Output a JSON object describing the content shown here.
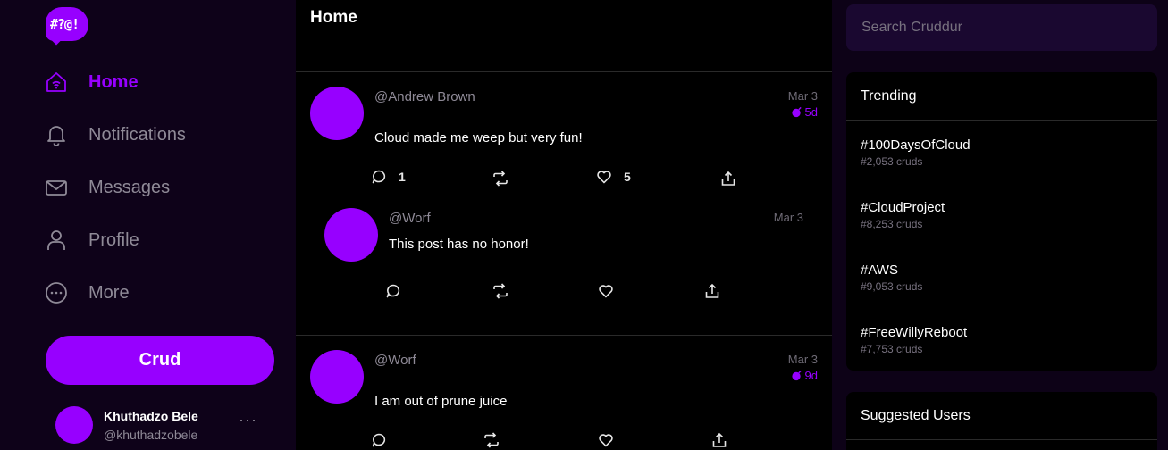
{
  "logo": {
    "text": "#?@!"
  },
  "nav": {
    "home": "Home",
    "notifications": "Notifications",
    "messages": "Messages",
    "profile": "Profile",
    "more": "More"
  },
  "crud_button": "Crud",
  "current_user": {
    "name": "Khuthadzo Bele",
    "handle": "@khuthadzobele",
    "menu": "···"
  },
  "feed": {
    "title": "Home",
    "posts": [
      {
        "handle": "@Andrew Brown",
        "date": "Mar 3",
        "expires": "5d",
        "body": "Cloud made me weep but very fun!",
        "replies": "1",
        "likes": "5"
      },
      {
        "handle": "@Worf",
        "date": "Mar 3",
        "body": "This post has no honor!"
      },
      {
        "handle": "@Worf",
        "date": "Mar 3",
        "expires": "9d",
        "body": "I am out of prune juice"
      }
    ]
  },
  "search": {
    "placeholder": "Search Cruddur"
  },
  "trending": {
    "title": "Trending",
    "items": [
      {
        "tag": "#100DaysOfCloud",
        "count": "#2,053 cruds"
      },
      {
        "tag": "#CloudProject",
        "count": "#8,253 cruds"
      },
      {
        "tag": "#AWS",
        "count": "#9,053 cruds"
      },
      {
        "tag": "#FreeWillyReboot",
        "count": "#7,753 cruds"
      }
    ]
  },
  "suggested": {
    "title": "Suggested Users"
  },
  "colors": {
    "accent": "#9700ff",
    "sidebar_bg": "#0e0219",
    "feed_bg": "#000000",
    "search_bg": "#1a0830"
  },
  "icons": [
    "home-icon",
    "bell-icon",
    "envelope-icon",
    "person-icon",
    "more-circle-icon",
    "reply-icon",
    "repost-icon",
    "heart-icon",
    "share-icon",
    "bomb-icon"
  ]
}
